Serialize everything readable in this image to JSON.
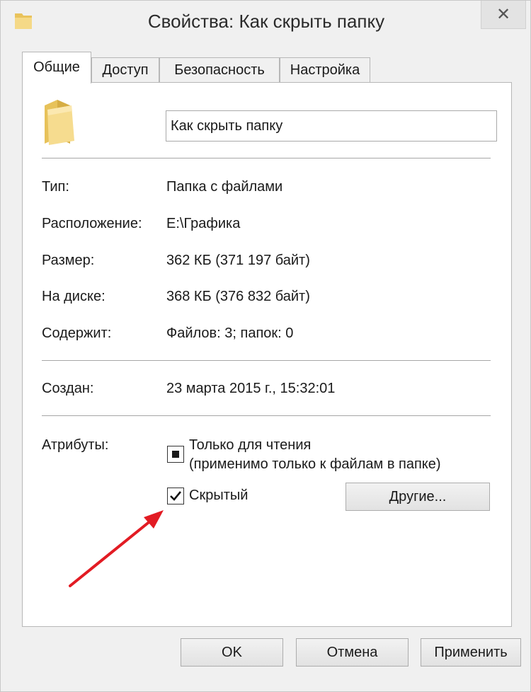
{
  "window": {
    "title": "Свойства: Как скрыть папку",
    "close_label": "✕"
  },
  "tabs": [
    {
      "label": "Общие",
      "active": true
    },
    {
      "label": "Доступ",
      "active": false
    },
    {
      "label": "Безопасность",
      "active": false
    },
    {
      "label": "Настройка",
      "active": false
    }
  ],
  "general": {
    "folder_name": "Как скрыть папку",
    "rows": [
      {
        "label": "Тип:",
        "value": "Папка с файлами"
      },
      {
        "label": "Расположение:",
        "value": "E:\\Графика"
      },
      {
        "label": "Размер:",
        "value": "362 КБ (371 197 байт)"
      },
      {
        "label": "На диске:",
        "value": "368 КБ (376 832 байт)"
      },
      {
        "label": "Содержит:",
        "value": "Файлов: 3; папок: 0"
      }
    ],
    "created": {
      "label": "Создан:",
      "value": "23 марта 2015 г., 15:32:01"
    },
    "attributes": {
      "label": "Атрибуты:",
      "readonly_line1": "Только для чтения",
      "readonly_line2": "(применимо только к файлам в папке)",
      "readonly_state": "indeterminate",
      "hidden_label": "Скрытый",
      "hidden_checked": true,
      "other_button": "Другие..."
    }
  },
  "footer": {
    "ok": "OK",
    "cancel": "Отмена",
    "apply": "Применить"
  },
  "colors": {
    "arrow": "#e21b23",
    "folder": "#f3d37b"
  }
}
